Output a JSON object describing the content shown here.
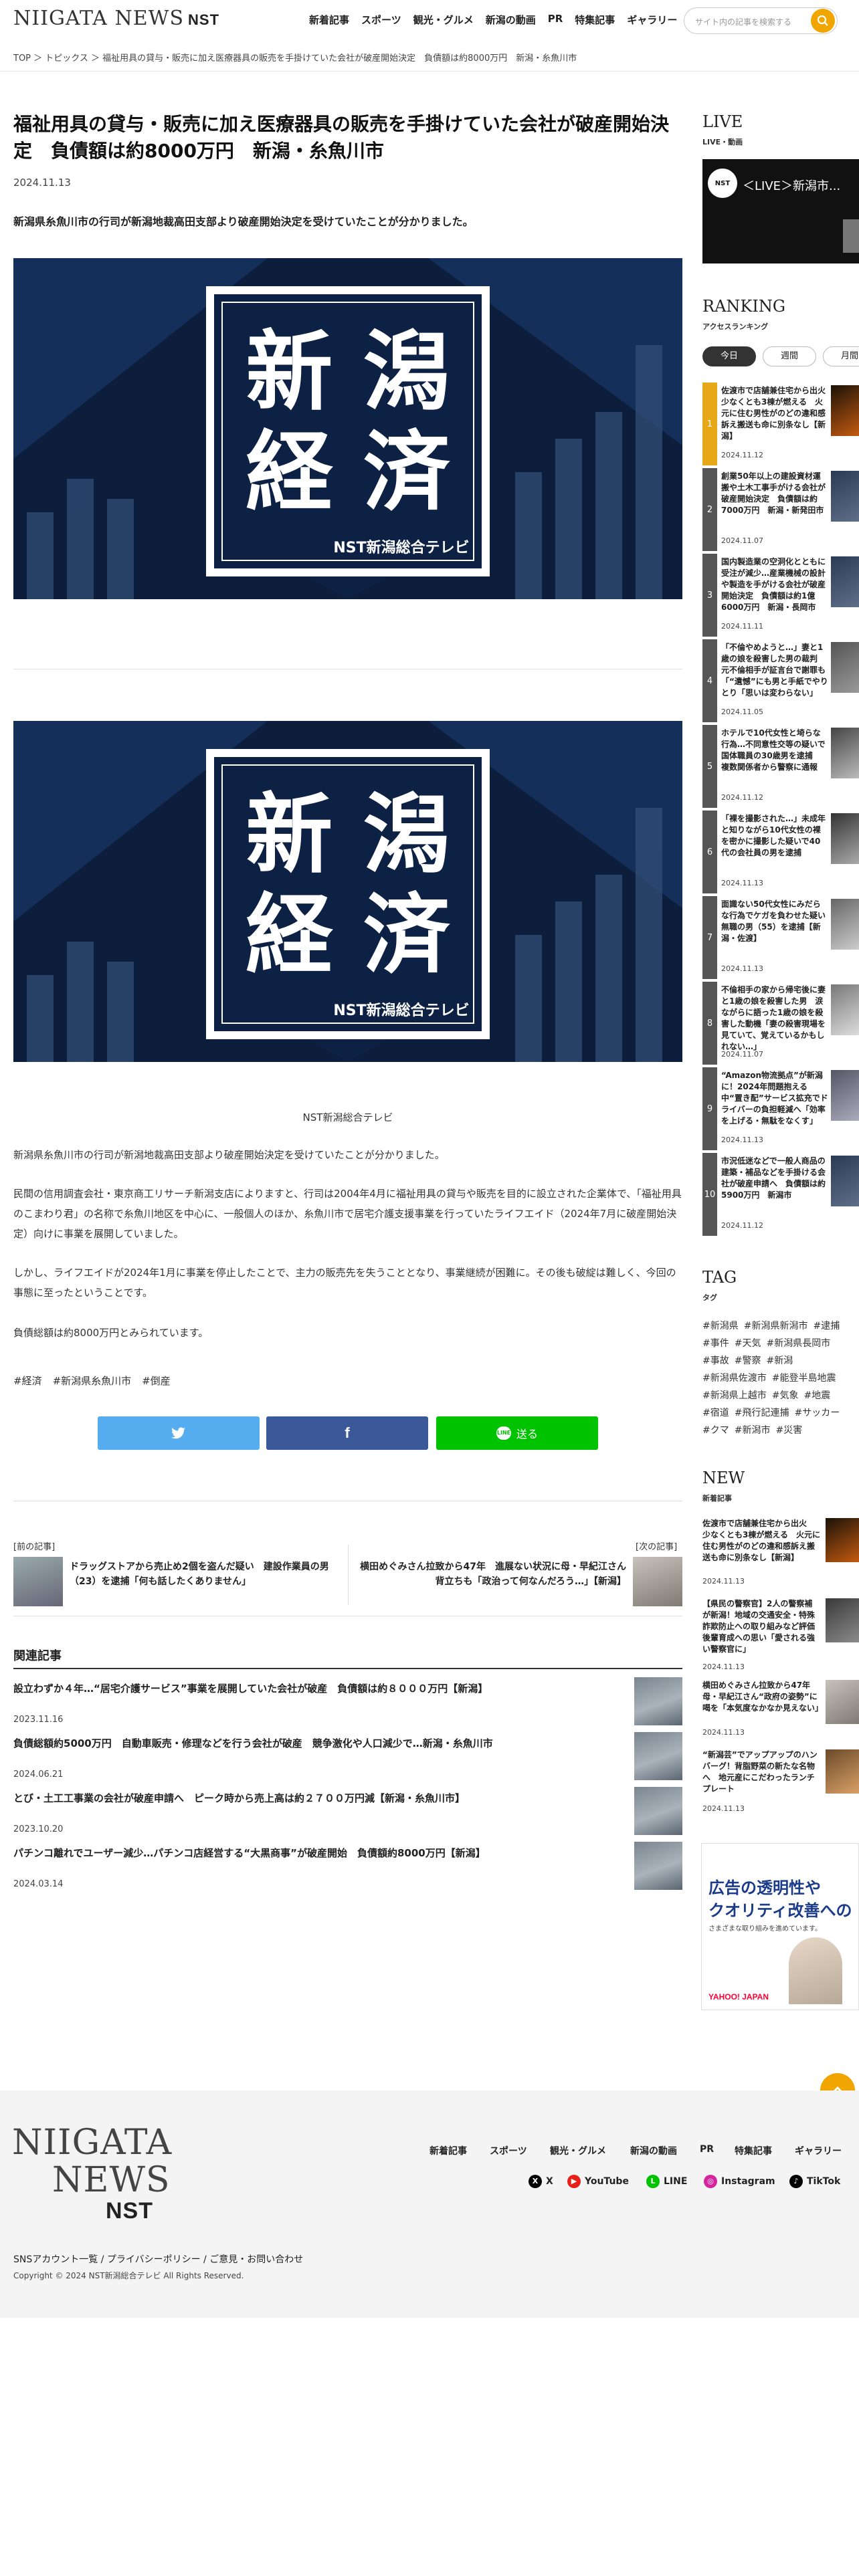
{
  "header": {
    "logo_text": "NIIGATA NEWS",
    "logo_brand": "NST",
    "nav": [
      "新着記事",
      "スポーツ",
      "観光・グルメ",
      "新潟の動画",
      "PR",
      "特集記事",
      "ギャラリー"
    ],
    "search_placeholder": "サイト内の記事を検索する"
  },
  "breadcrumb": "TOP ＞ トピックス ＞ 福祉用具の貸与・販売に加え医療器具の販売を手掛けていた会社が破産開始決定　負債額は約8000万円　新潟・糸魚川市",
  "article": {
    "title": "福祉用具の貸与・販売に加え医療器具の販売を手掛けていた会社が破産開始決定　負債額は約8000万円　新潟・糸魚川市",
    "date": "2024.11.13",
    "lead": "新潟県糸魚川市の行司が新潟地裁高田支部より破産開始決定を受けていたことが分かりました。",
    "hero_title_line1": "新 潟",
    "hero_title_line2": "経 済",
    "hero_brand": "NST新潟総合テレビ",
    "caption": "NST新潟総合テレビ",
    "paragraphs": [
      "新潟県糸魚川市の行司が新潟地裁高田支部より破産開始決定を受けていたことが分かりました。",
      "民間の信用調査会社・東京商工リサーチ新潟支店によりますと、行司は2004年4月に福祉用具の貸与や販売を目的に設立された企業体で、「福祉用具のこまわり君」の名称で糸魚川地区を中心に、一般個人のほか、糸魚川市で居宅介護支援事業を行っていたライフエイド（2024年7月に破産開始決定）向けに事業を展開していました。",
      "しかし、ライフエイドが2024年1月に事業を停止したことで、主力の販売先を失うこととなり、事業継続が困難に。その後も破綻は難しく、今回の事態に至ったということです。",
      "負債総額は約8000万円とみられています。"
    ],
    "tags": [
      "#経済",
      "#新潟県糸魚川市",
      "#倒産"
    ],
    "share": {
      "twitter": "",
      "facebook": "",
      "line": "送る"
    }
  },
  "prev_next": {
    "prev_label": "[前の記事]",
    "prev_title": "ドラッグストアから売止め2個を盗んだ疑い　建設作業員の男（23）を逮捕「何も話したくありません」",
    "next_label": "[次の記事]",
    "next_title": "横田めぐみさん拉致から47年　進展ない状況に母・早紀江さん背立ちも「政治って何なんだろう…」【新潟】"
  },
  "related": {
    "heading": "関連記事",
    "items": [
      {
        "title": "設立わずか４年…“居宅介護サービス”事業を展開していた会社が破産　負債額は約８０００万円【新潟】",
        "date": "2023.11.16"
      },
      {
        "title": "負債総額約5000万円　自動車販売・修理などを行う会社が破産　競争激化や人口減少で…新潟・糸魚川市",
        "date": "2024.06.21"
      },
      {
        "title": "とび・土工工事業の会社が破産申請へ　ピーク時から売上高は約２７００万円減【新潟・糸魚川市】",
        "date": "2023.10.20"
      },
      {
        "title": "パチンコ離れでユーザー減少…パチンコ店経営する“大黒商事”が破産開始　負債額約8000万円【新潟】",
        "date": "2024.03.14"
      }
    ]
  },
  "sidebar": {
    "live_heading": "LIVE",
    "live_sub": "LIVE・動画",
    "live_video_title": "＜LIVE＞新潟市...",
    "ranking_heading": "RANKING",
    "ranking_sub": "アクセスランキング",
    "ranking_tabs": [
      "今日",
      "週間",
      "月間"
    ],
    "ranking": [
      {
        "rank": "1",
        "title": "佐渡市で店舗兼住宅から出火　少なくとも3棟が燃える　火元に住む男性がのどの違和感訴え搬送も命に別条なし【新潟】",
        "date": "2024.11.12"
      },
      {
        "rank": "2",
        "title": "創業50年以上の建設資材運搬や土木工事手がける会社が破産開始決定　負債額は約7000万円　新潟・新発田市",
        "date": "2024.11.07"
      },
      {
        "rank": "3",
        "title": "国内製造業の空洞化とともに受注が減少…産業機械の設計や製造を手がける会社が破産開始決定　負債額は約1億6000万円　新潟・長岡市",
        "date": "2024.11.11"
      },
      {
        "rank": "4",
        "title": "「不倫やめようと…」妻と1歳の娘を殺害した男の裁判　元不倫相手が証言台で謝罪も「“遺憾”にも男と手紙でやりとり「思いは変わらない」",
        "date": "2024.11.05"
      },
      {
        "rank": "5",
        "title": "ホテルで10代女性と埼らな行為…不同意性交等の疑いで国体職員の30歳男を逮捕　複数関係者から警察に通報",
        "date": "2024.11.12"
      },
      {
        "rank": "6",
        "title": "「裸を撮影された…」未成年と知りながら10代女性の裸を密かに撮影した疑いで40代の会社員の男を逮捕",
        "date": "2024.11.13"
      },
      {
        "rank": "7",
        "title": "面識ない50代女性にみだらな行為でケガを負わせた疑い　無職の男（55）を逮捕【新潟・佐渡】",
        "date": "2024.11.13"
      },
      {
        "rank": "8",
        "title": "不倫相手の家から帰宅後に妻と1歳の娘を殺害した男　涙ながらに語った1歳の娘を殺害した動機「妻の殺害現場を見ていて、覚えているかもしれない…」",
        "date": "2024.11.07"
      },
      {
        "rank": "9",
        "title": "“Amazon物流拠点”が新潟に！2024年問題抱える中“置き配”サービス拡充でドライバーの負担軽減へ「効率を上げる・無駄をなくす」",
        "date": "2024.11.13"
      },
      {
        "rank": "10",
        "title": "市況低迷などで一般人商品の建築・補品などを手掛ける会社が破産申請へ　負債額は約5900万円　新潟市",
        "date": "2024.11.12"
      }
    ],
    "tag_heading": "TAG",
    "tag_sub": "タグ",
    "tags": [
      "#新潟県",
      "#新潟県新潟市",
      "#逮捕",
      "#事件",
      "#天気",
      "#新潟県長岡市",
      "#事故",
      "#警察",
      "#新潟",
      "#新潟県佐渡市",
      "#能登半島地震",
      "#新潟県上越市",
      "#気象",
      "#地震",
      "#宿道",
      "#飛行記連捕",
      "#サッカー",
      "#クマ",
      "#新潟市",
      "#災害"
    ],
    "new_heading": "NEW",
    "new_sub": "新着記事",
    "new_items": [
      {
        "title": "佐渡市で店舗兼住宅から出火　少なくとも3棟が燃える　火元に住む男性がのどの違和感訴え搬送も命に別条なし【新潟】",
        "date": "2024.11.13"
      },
      {
        "title": "【県民の警察官】2人の警察補が新潟！地域の交通安全・特殊詐欺防止への取り組みなど評価　後輩育成への思い「愛される強い警察官に」",
        "date": "2024.11.13"
      },
      {
        "title": "横田めぐみさん拉致から47年　母・早紀江さん“政府の姿勢”に喝を「本気度なかなか見えない」",
        "date": "2024.11.13"
      },
      {
        "title": "“新潟芸”でアップアップのハンバーグ！背脂野菜の新たな名物へ　地元産にこだわったランチプレート",
        "date": "2024.11.13"
      }
    ],
    "ad_line1": "広告の透明性や",
    "ad_line2": "クオリティ改善への",
    "ad_line3": "さまざまな取り組みを進めています。",
    "ad_brand": "YAHOO! JAPAN"
  },
  "footer": {
    "logo_line1": "NIIGATA",
    "logo_line2": "NEWS",
    "logo_brand": "NST",
    "nav": [
      "新着記事",
      "スポーツ",
      "観光・グルメ",
      "新潟の動画",
      "PR",
      "特集記事",
      "ギャラリー"
    ],
    "sns": [
      "X",
      "YouTube",
      "LINE",
      "Instagram",
      "TikTok"
    ],
    "links": "SNSアカウント一覧 / プライバシーポリシー / ご意見・お問い合わせ",
    "copyright": "Copyright © 2024 NST新潟総合テレビ All Rights Reserved."
  },
  "colors": {
    "accent": "#f0a500",
    "twitter": "#55acee",
    "facebook": "#3b5998",
    "line": "#00c300",
    "hero_bg": "#0c1e3c"
  }
}
